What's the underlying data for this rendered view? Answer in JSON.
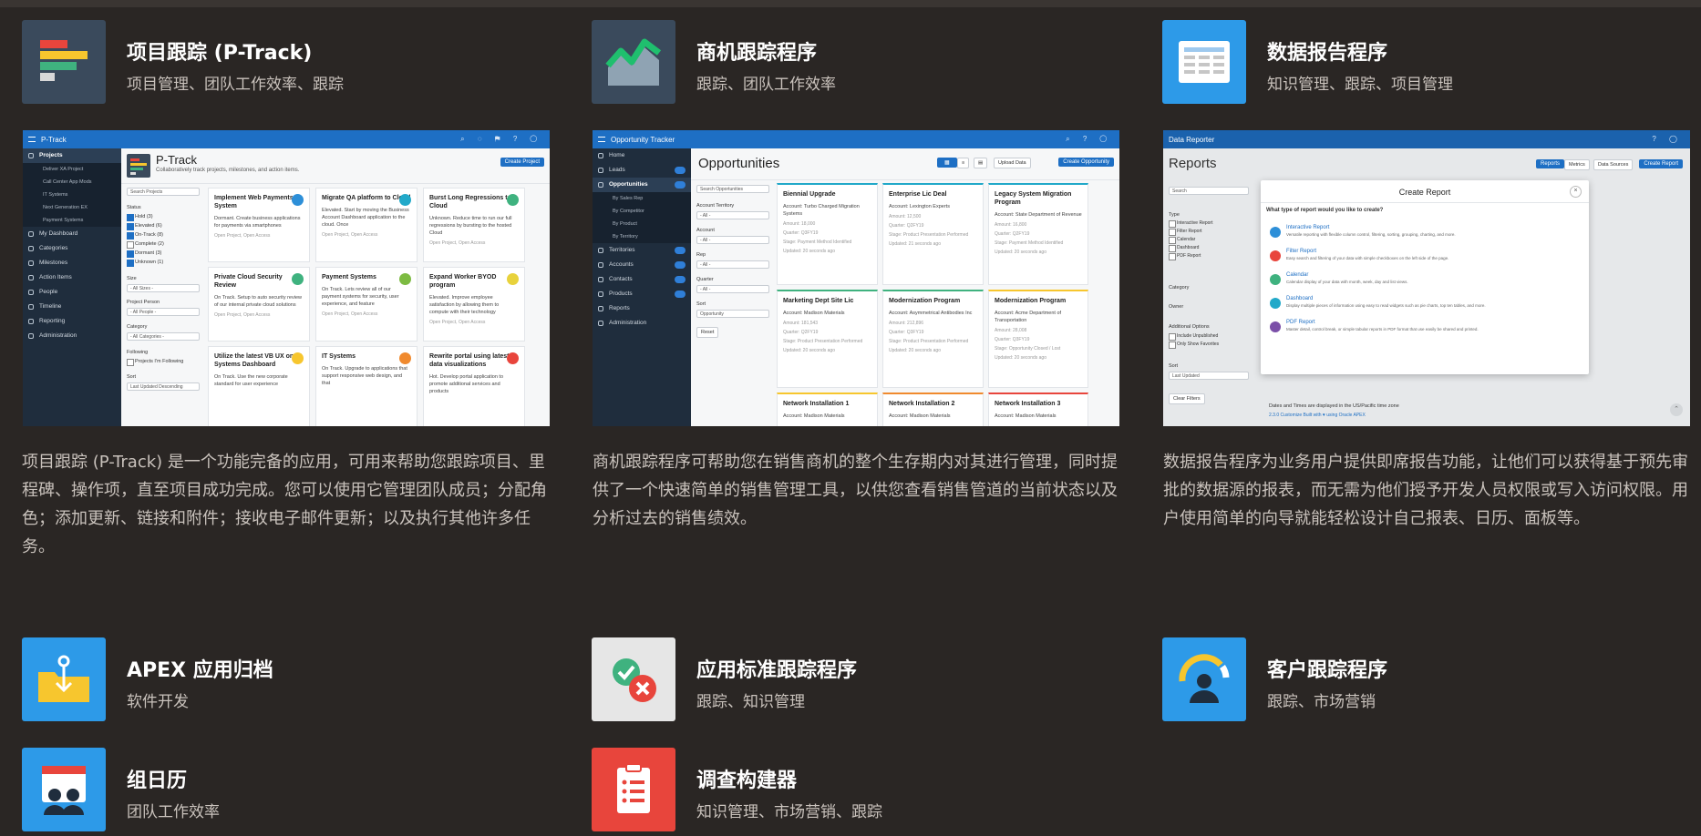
{
  "colors": {
    "background": "#2a2624",
    "subtitle": "#c9c2bc",
    "oracle_blue": "#1e6fc4"
  },
  "apps": [
    {
      "title": "项目跟踪 (P-Track)",
      "tags": "项目管理、团队工作效率、跟踪",
      "icon": "bar-list-icon",
      "icon_bg": "#3a4a5c",
      "description": "项目跟踪 (P-Track) 是一个功能完备的应用，可用来帮助您跟踪项目、里程碑、操作项，直至项目成功完成。您可以使用它管理团队成员；分配角色；添加更新、链接和附件；接收电子邮件更新；以及执行其他许多任务。"
    },
    {
      "title": "商机跟踪程序",
      "tags": "跟踪、团队工作效率",
      "icon": "growth-chart-icon",
      "icon_bg": "#3a4a5c",
      "description": "商机跟踪程序可帮助您在销售商机的整个生存期内对其进行管理，同时提供了一个快速简单的销售管理工具，以供您查看销售管道的当前状态以及分析过去的销售绩效。"
    },
    {
      "title": "数据报告程序",
      "tags": "知识管理、跟踪、项目管理",
      "icon": "report-table-icon",
      "icon_bg": "#2d9ae8",
      "description": "数据报告程序为业务用户提供即席报告功能，让他们可以获得基于预先审批的数据源的报表，而无需为他们授予开发人员权限或写入访问权限。用户使用简单的向导就能轻松设计自己报表、日历、面板等。"
    },
    {
      "title": "APEX 应用归档",
      "tags": "软件开发",
      "icon": "archive-folder-icon",
      "icon_bg": "#2d9ae8"
    },
    {
      "title": "应用标准跟踪程序",
      "tags": "跟踪、知识管理",
      "icon": "check-cross-icon",
      "icon_bg": "#e6e6e6"
    },
    {
      "title": "客户跟踪程序",
      "tags": "跟踪、市场营销",
      "icon": "customer-gauge-icon",
      "icon_bg": "#2d9ae8"
    },
    {
      "title": "组日历",
      "tags": "团队工作效率",
      "icon": "group-calendar-icon",
      "icon_bg": "#2d9ae8"
    },
    {
      "title": "调查构建器",
      "tags": "知识管理、市场营销、跟踪",
      "icon": "survey-clipboard-icon",
      "icon_bg": "#e8453c"
    }
  ],
  "ptrack": {
    "app_name": "P-Track",
    "nav": [
      "Projects",
      "Deliver XA Project",
      "Call Center App Mods",
      "IT Systems",
      "Next Generation EX",
      "Payment Systems",
      "My Dashboard",
      "Categories",
      "Milestones",
      "Action Items",
      "People",
      "Timeline",
      "Reporting",
      "Administration"
    ],
    "page_title": "P-Track",
    "page_sub": "Collaboratively track projects, milestones, and action items.",
    "create_btn": "Create Project",
    "search": "Search Projects",
    "filters": {
      "status": "Status",
      "status_opts": [
        "Hold (3)",
        "Elevated (6)",
        "On-Track (8)",
        "Complete (2)",
        "Dormant (3)",
        "Unknown (1)"
      ],
      "size": "Size",
      "size_val": "- All Sizes -",
      "person": "Project Person",
      "person_val": "- All People -",
      "category": "Category",
      "category_val": "- All Categories -",
      "following": "Following",
      "following_opt": "Projects I'm Following",
      "sort": "Sort",
      "sort_val": "Last Updated Descending"
    },
    "cards": [
      {
        "t": "Implement Web Payments System",
        "b": "Dormant. Create business applications for payments via smartphones",
        "f": "Open Project, Open Access"
      },
      {
        "t": "Migrate QA platform to Cloud",
        "b": "Elevated. Start by moving the Business Account Dashboard application to the cloud. Once",
        "f": "Open Project, Open Access"
      },
      {
        "t": "Burst Long Regressions to Cloud",
        "b": "Unknown. Reduce time to run our full regressions by bursting to the hosted Cloud",
        "f": "Open Project, Open Access"
      },
      {
        "t": "Private Cloud Security Review",
        "b": "On Track. Setup to auto security review of our internal private cloud solutions",
        "f": "Open Project, Open Access"
      },
      {
        "t": "Payment Systems",
        "b": "On Track. Lets review all of our payment systems for security, user experience, and feature",
        "f": "Open Project, Open Access"
      },
      {
        "t": "Expand Worker BYOD program",
        "b": "Elevated. Improve employee satisfaction by allowing them to compute with their technology",
        "f": "Open Project, Open Access"
      },
      {
        "t": "Utilize the latest VB UX on IT Systems Dashboard",
        "b": "On Track. Use the new corporate standard for user experience",
        "f": ""
      },
      {
        "t": "IT Systems",
        "b": "On Track. Upgrade to applications that support responsive web design, and that",
        "f": ""
      },
      {
        "t": "Rewrite portal using latest data visualizations",
        "b": "Hot. Develop portal application to promote additional services and products",
        "f": ""
      }
    ]
  },
  "opp": {
    "app_name": "Opportunity Tracker",
    "nav": [
      "Home",
      "Leads",
      "Opportunities",
      "By Sales Rep",
      "By Competitor",
      "By Product",
      "By Territory",
      "Territories",
      "Accounts",
      "Contacts",
      "Products",
      "Reports",
      "Administration"
    ],
    "page_title": "Opportunities",
    "upload_btn": "Upload Data",
    "create_btn": "Create Opportunity",
    "search": "Search Opportunities",
    "filters": {
      "territory": "Account Territory",
      "territory_val": "- All -",
      "account": "Account",
      "account_val": "- All -",
      "rep": "Rep",
      "rep_val": "- All -",
      "quarter": "Quarter",
      "quarter_val": "- All -",
      "sort": "Sort",
      "sort_val": "Opportunity",
      "reset": "Reset"
    },
    "cards": [
      {
        "t": "Biennial Upgrade",
        "b": "Account: Turbo Charged Migration Systems",
        "m": "Amount: 18,000",
        "q": "Quarter: Q3FY19",
        "s": "Stage: Payment Method Identified",
        "u": "Updated: 20 seconds ago"
      },
      {
        "t": "Enterprise Lic Deal",
        "b": "Account: Lexington Experts",
        "m": "Amount: 12,500",
        "q": "Quarter: Q2FY19",
        "s": "Stage: Product Presentation Performed",
        "u": "Updated: 21 seconds ago"
      },
      {
        "t": "Legacy System Migration Program",
        "b": "Account: State Department of Revenue",
        "m": "Amount: 16,800",
        "q": "Quarter: Q2FY19",
        "s": "Stage: Payment Method Identified",
        "u": "Updated: 20 seconds ago"
      },
      {
        "t": "Marketing Dept Site Lic",
        "b": "Account: Madison Materials",
        "m": "Amount: 181,543",
        "q": "Quarter: Q2FY19",
        "s": "Stage: Product Presentation Performed",
        "u": "Updated: 20 seconds ago"
      },
      {
        "t": "Modernization Program",
        "b": "Account: Asymmetrical Antibodies Inc",
        "m": "Amount: 212,896",
        "q": "Quarter: Q3FY19",
        "s": "Stage: Product Presentation Performed",
        "u": "Updated: 20 seconds ago"
      },
      {
        "t": "Modernization Program",
        "b": "Account: Acme Department of Transportation",
        "m": "Amount: 28,008",
        "q": "Quarter: Q3FY19",
        "s": "Stage: Opportunity Closed / Lost",
        "u": "Updated: 20 seconds ago"
      },
      {
        "t": "Network Installation 1",
        "b": "Account: Madison Materials",
        "m": "",
        "q": "",
        "s": "",
        "u": ""
      },
      {
        "t": "Network Installation 2",
        "b": "Account: Madison Materials",
        "m": "",
        "q": "",
        "s": "",
        "u": ""
      },
      {
        "t": "Network Installation 3",
        "b": "Account: Madison Materials",
        "m": "",
        "q": "",
        "s": "",
        "u": ""
      }
    ]
  },
  "reporter": {
    "app_name": "Data Reporter",
    "page_title": "Reports",
    "tabs": [
      "Reports",
      "Metrics",
      "Data Sources",
      "Create Report"
    ],
    "search": "Search",
    "filters": {
      "type": "Type",
      "type_opts": [
        "Interactive Report",
        "Filter Report",
        "Calendar",
        "Dashboard",
        "PDF Report"
      ],
      "category": "Category",
      "owner": "Owner",
      "additional": "Additional Options",
      "add_opts": [
        "Include Unpublished",
        "Only Show Favorites"
      ],
      "sort": "Sort",
      "sort_val": "Last Updated",
      "clear": "Clear Filters"
    },
    "dialog": {
      "title": "Create Report",
      "question": "What type of report would you like to create?",
      "options": [
        {
          "t": "Interactive Report",
          "d": "Versatile reporting with flexible column control, filtering, sorting, grouping, charting, and more.",
          "c": "#2d8fd8"
        },
        {
          "t": "Filter Report",
          "d": "Easy search and filtering of your data with simple checkboxes on the left side of the page.",
          "c": "#e8453c"
        },
        {
          "t": "Calendar",
          "d": "Calendar display of your data with month, week, day and list views.",
          "c": "#3fb27f"
        },
        {
          "t": "Dashboard",
          "d": "Display multiple pieces of information using easy to read widgets such as pie charts, top ten tables, and more.",
          "c": "#22a9c9"
        },
        {
          "t": "PDF Report",
          "d": "Master detail, control break, or simple tabular reports in PDF format that use easily be shared and printed.",
          "c": "#7b4fa8"
        }
      ]
    },
    "footer1": "Dates and Times are displayed in the US/Pacific time zone",
    "footer2": "2.3.0   Customize   Built with ♥ using Oracle APEX"
  }
}
